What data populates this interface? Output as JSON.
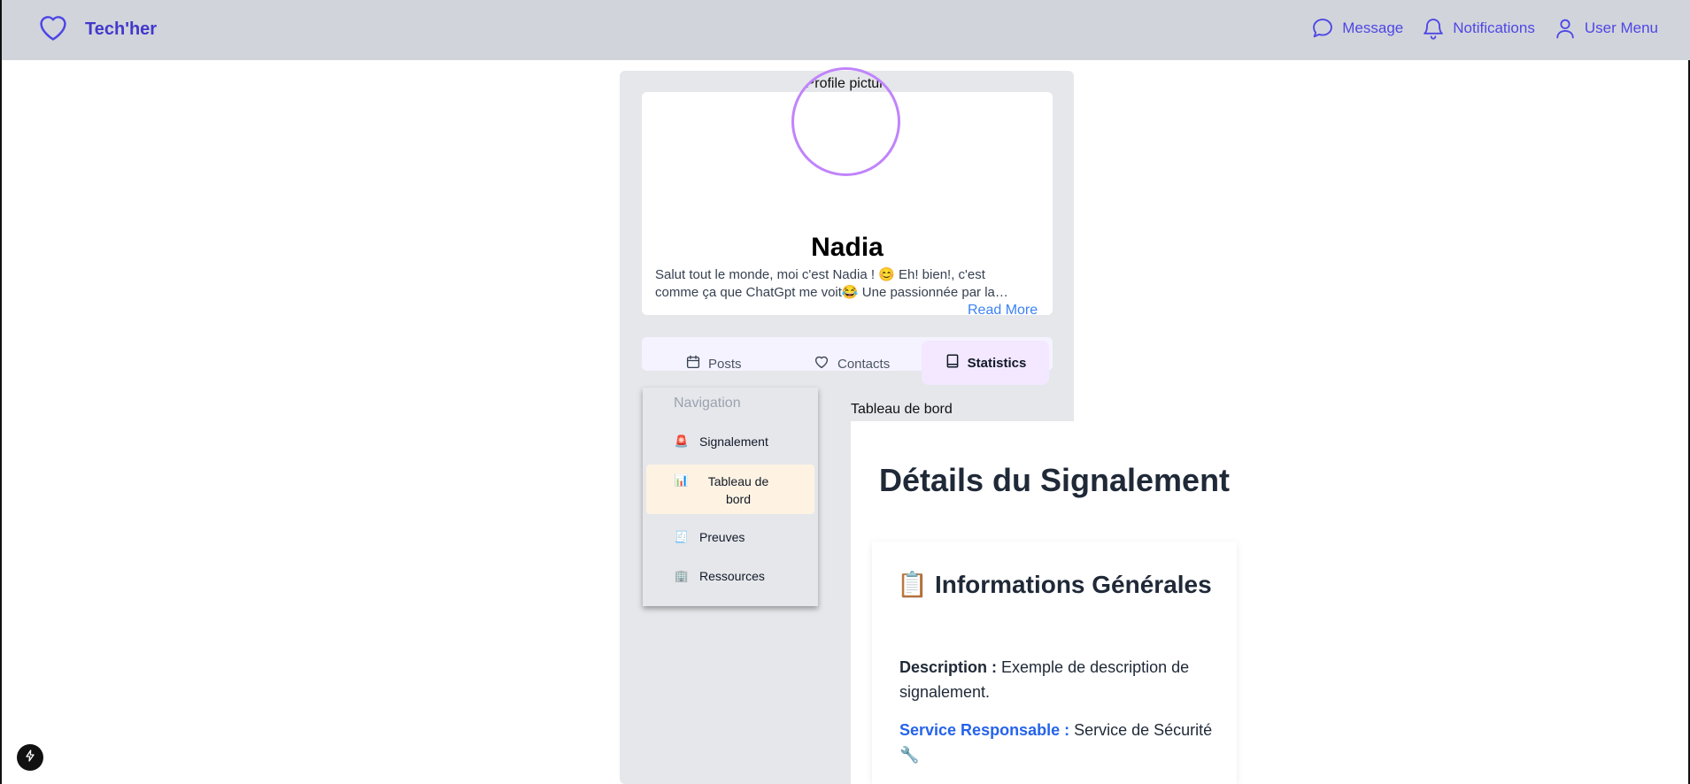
{
  "header": {
    "brand": "Tech'her",
    "nav": {
      "message": "Message",
      "notifications": "Notifications",
      "user_menu": "User Menu"
    },
    "accent_color": "#4f46e5"
  },
  "profile": {
    "avatar_alt": "Profile picture",
    "name": "Nadia",
    "bio": "Salut tout le monde, moi c'est Nadia ! 😊 Eh! bien!, c'est comme ça que ChatGpt me voit😂 Une passionnée par la technologie et les…",
    "read_more": "Read More"
  },
  "tabs": [
    {
      "label": "Posts",
      "icon": "calendar-icon"
    },
    {
      "label": "Contacts",
      "icon": "heart-icon"
    },
    {
      "label": "Statistics",
      "icon": "book-icon",
      "active": true
    }
  ],
  "sidenav": {
    "title": "Navigation",
    "items": [
      {
        "icon": "🚨",
        "label": "Signalement"
      },
      {
        "icon": "📊",
        "label": "Tableau de bord",
        "active": true
      },
      {
        "icon": "🧾",
        "label": "Preuves"
      },
      {
        "icon": "🏢",
        "label": "Ressources"
      }
    ]
  },
  "content": {
    "breadcrumb": "Tableau de bord",
    "title": "Détails du Signalement",
    "info": {
      "title": "📋 Informations Générales",
      "description_label": "Description :",
      "description_value": "Exemple de description de signalement.",
      "service_label": "Service Responsable :",
      "service_value": "Service de Sécurité🔧"
    }
  }
}
